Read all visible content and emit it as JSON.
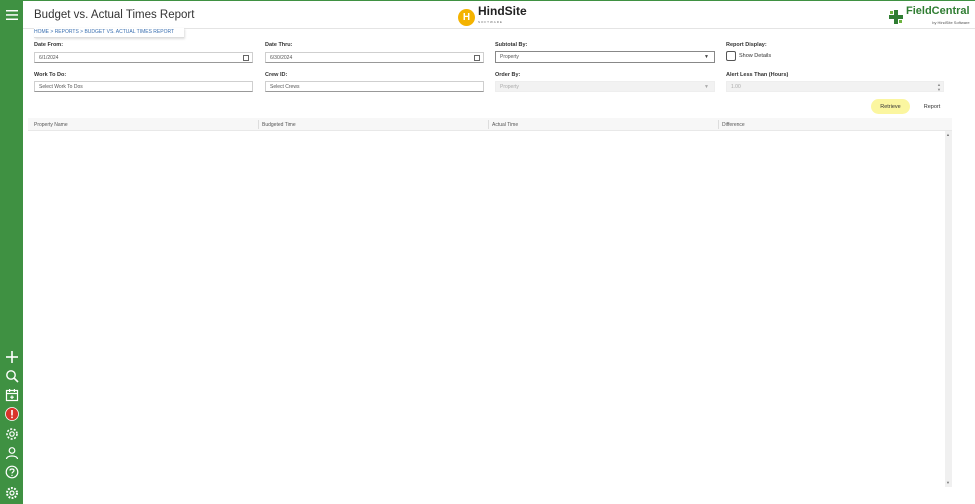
{
  "header": {
    "title": "Budget vs. Actual Times Report",
    "hindsite_logo": {
      "name": "HindSite",
      "sub": "SOFTWARE"
    },
    "fieldcentral_logo": {
      "name": "FieldCentral",
      "sub": "by HindSite Software"
    }
  },
  "breadcrumb": "HOME > REPORTS > BUDGET VS. ACTUAL TIMES REPORT",
  "sidebar": {
    "top_icon": "hamburger-menu-icon",
    "icons": [
      "plus-icon",
      "search-icon",
      "calendar-icon",
      "alert-icon",
      "gear-icon",
      "user-icon",
      "help-icon",
      "settings-cog-icon"
    ]
  },
  "form": {
    "date_from": {
      "label": "Date From:",
      "value": "6/1/2024"
    },
    "date_thru": {
      "label": "Date Thru:",
      "value": "6/30/2024"
    },
    "subtotal_by": {
      "label": "Subtotal By:",
      "value": "Property"
    },
    "report_display": {
      "label": "Report Display:",
      "checkbox_label": "Show Details",
      "checked": false
    },
    "work_to_do": {
      "label": "Work To Do:",
      "placeholder": "Select Work To Dos"
    },
    "crew_id": {
      "label": "Crew ID:",
      "placeholder": "Select Crews"
    },
    "order_by": {
      "label": "Order By:",
      "value": "Property"
    },
    "alert_less_than": {
      "label": "Alert Less Than (Hours)",
      "value": "1.00"
    }
  },
  "buttons": {
    "retrieve": "Retrieve",
    "report": "Report"
  },
  "grid": {
    "columns": [
      "Property Name",
      "Budgeted Time",
      "Actual Time",
      "Difference"
    ]
  },
  "colors": {
    "sidebar": "#3f9142",
    "retrieve_highlight": "#fbf6a0",
    "breadcrumb_link": "#3a6fb0",
    "alert_icon": "#d9342b"
  }
}
